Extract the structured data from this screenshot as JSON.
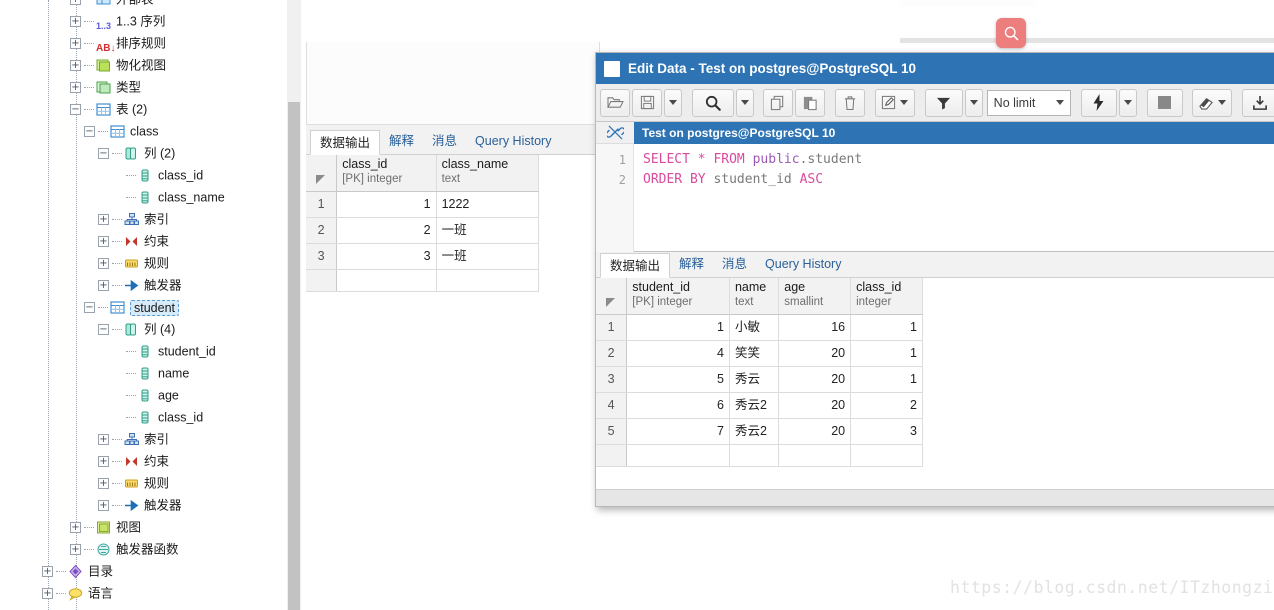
{
  "tree": {
    "items": [
      {
        "label": "外部表",
        "icon": "foreign-table-icon",
        "indent": 4,
        "twisty": "plus",
        "clipped": true,
        "selected": false
      },
      {
        "label": "1..3 序列",
        "icon": "sequence-icon",
        "indent": 4,
        "twisty": "plus",
        "selected": false
      },
      {
        "label": "排序规则",
        "icon": "collation-icon",
        "indent": 4,
        "twisty": "plus",
        "selected": false
      },
      {
        "label": "物化视图",
        "icon": "matview-icon",
        "indent": 4,
        "twisty": "plus",
        "selected": false
      },
      {
        "label": "类型",
        "icon": "type-icon",
        "indent": 4,
        "twisty": "plus",
        "selected": false
      },
      {
        "label": "表 (2)",
        "icon": "tables-icon",
        "indent": 4,
        "twisty": "minus",
        "selected": false
      },
      {
        "label": "class",
        "icon": "table-icon",
        "indent": 5,
        "twisty": "minus",
        "selected": false
      },
      {
        "label": "列 (2)",
        "icon": "columns-icon",
        "indent": 6,
        "twisty": "minus",
        "selected": false
      },
      {
        "label": "class_id",
        "icon": "column-icon",
        "indent": 7,
        "twisty": "none",
        "selected": false
      },
      {
        "label": "class_name",
        "icon": "column-icon",
        "indent": 7,
        "twisty": "none",
        "selected": false
      },
      {
        "label": "索引",
        "icon": "index-icon",
        "indent": 6,
        "twisty": "plus",
        "selected": false
      },
      {
        "label": "约束",
        "icon": "constraint-icon",
        "indent": 6,
        "twisty": "plus",
        "selected": false
      },
      {
        "label": "规则",
        "icon": "rule-icon",
        "indent": 6,
        "twisty": "plus",
        "selected": false
      },
      {
        "label": "触发器",
        "icon": "trigger-icon",
        "indent": 6,
        "twisty": "plus",
        "selected": false
      },
      {
        "label": "student",
        "icon": "table-icon",
        "indent": 5,
        "twisty": "minus",
        "selected": true
      },
      {
        "label": "列 (4)",
        "icon": "columns-icon",
        "indent": 6,
        "twisty": "minus",
        "selected": false
      },
      {
        "label": "student_id",
        "icon": "column-icon",
        "indent": 7,
        "twisty": "none",
        "selected": false
      },
      {
        "label": "name",
        "icon": "column-icon",
        "indent": 7,
        "twisty": "none",
        "selected": false
      },
      {
        "label": "age",
        "icon": "column-icon",
        "indent": 7,
        "twisty": "none",
        "selected": false
      },
      {
        "label": "class_id",
        "icon": "column-icon",
        "indent": 7,
        "twisty": "none",
        "selected": false
      },
      {
        "label": "索引",
        "icon": "index-icon",
        "indent": 6,
        "twisty": "plus",
        "selected": false
      },
      {
        "label": "约束",
        "icon": "constraint-icon",
        "indent": 6,
        "twisty": "plus",
        "selected": false
      },
      {
        "label": "规则",
        "icon": "rule-icon",
        "indent": 6,
        "twisty": "plus",
        "selected": false
      },
      {
        "label": "触发器",
        "icon": "trigger-icon",
        "indent": 6,
        "twisty": "plus",
        "selected": false
      },
      {
        "label": "视图",
        "icon": "view-icon",
        "indent": 4,
        "twisty": "plus",
        "selected": false
      },
      {
        "label": "触发器函数",
        "icon": "trigger-function-icon",
        "indent": 4,
        "twisty": "plus",
        "selected": false
      },
      {
        "label": "目录",
        "icon": "catalog-icon",
        "indent": 2,
        "twisty": "plus",
        "selected": false
      },
      {
        "label": "语言",
        "icon": "language-icon",
        "indent": 2,
        "twisty": "plus",
        "selected": false
      }
    ]
  },
  "background_result": {
    "tabs": [
      {
        "label": "数据输出",
        "active": true
      },
      {
        "label": "解释",
        "active": false
      },
      {
        "label": "消息",
        "active": false
      },
      {
        "label": "Query History",
        "active": false
      }
    ],
    "columns": [
      {
        "name": "class_id",
        "type": "[PK] integer",
        "align": "right"
      },
      {
        "name": "class_name",
        "type": "text",
        "align": "left"
      }
    ],
    "rows": [
      {
        "n": "1",
        "cells": [
          "1",
          "1222"
        ]
      },
      {
        "n": "2",
        "cells": [
          "2",
          "一班"
        ]
      },
      {
        "n": "3",
        "cells": [
          "3",
          "一班"
        ]
      }
    ]
  },
  "search_badge": {
    "icon": "search-icon",
    "color": "#ec7e7e"
  },
  "dialog": {
    "title": "Edit Data - Test on postgres@PostgreSQL 10",
    "titlebar_color": "#2e74b5",
    "toolbar": [
      {
        "name": "open-file-button",
        "icon": "folder-open-icon",
        "type": "button"
      },
      {
        "name": "save-file-button",
        "icon": "save-disk-icon",
        "type": "button"
      },
      {
        "name": "save-dropdown-button",
        "icon": "chevron-down-icon",
        "type": "dropdown"
      },
      {
        "name": "find-button",
        "icon": "search-icon",
        "type": "button"
      },
      {
        "name": "find-dropdown-button",
        "icon": "chevron-down-icon",
        "type": "dropdown"
      },
      {
        "name": "copy-button",
        "icon": "copy-icon",
        "type": "button"
      },
      {
        "name": "paste-button",
        "icon": "paste-icon",
        "type": "button"
      },
      {
        "name": "delete-button",
        "icon": "trash-icon",
        "type": "button"
      },
      {
        "name": "edit-button",
        "icon": "pencil-square-icon",
        "type": "dropdown-button"
      },
      {
        "name": "filter-button",
        "icon": "funnel-icon",
        "type": "button"
      },
      {
        "name": "filter-dropdown-button",
        "icon": "chevron-down-icon",
        "type": "dropdown"
      },
      {
        "name": "row-limit-select",
        "icon": "chevron-down-icon",
        "type": "select",
        "value": "No limit"
      },
      {
        "name": "execute-button",
        "icon": "lightning-bolt-icon",
        "type": "button"
      },
      {
        "name": "execute-dropdown-button",
        "icon": "chevron-down-icon",
        "type": "dropdown"
      },
      {
        "name": "stop-button",
        "icon": "stop-square-icon",
        "type": "button"
      },
      {
        "name": "clear-button",
        "icon": "eraser-icon",
        "type": "dropdown-button"
      },
      {
        "name": "download-button",
        "icon": "download-icon",
        "type": "button"
      }
    ],
    "limit": {
      "value": "No limit"
    },
    "editor": {
      "connection_icon": "broken-link-icon",
      "connection_label": "Test on postgres@PostgreSQL 10",
      "lines": [
        {
          "num": "1",
          "tokens": [
            {
              "t": "SELECT",
              "c": "kw"
            },
            {
              "t": " ",
              "c": "plain"
            },
            {
              "t": "*",
              "c": "op"
            },
            {
              "t": " ",
              "c": "plain"
            },
            {
              "t": "FROM",
              "c": "kw"
            },
            {
              "t": " ",
              "c": "plain"
            },
            {
              "t": "public",
              "c": "schema"
            },
            {
              "t": ".",
              "c": "ident"
            },
            {
              "t": "student",
              "c": "ident"
            }
          ]
        },
        {
          "num": "2",
          "tokens": [
            {
              "t": "ORDER",
              "c": "kw"
            },
            {
              "t": " ",
              "c": "plain"
            },
            {
              "t": "BY",
              "c": "kw"
            },
            {
              "t": " ",
              "c": "plain"
            },
            {
              "t": "student_id",
              "c": "ident"
            },
            {
              "t": " ",
              "c": "plain"
            },
            {
              "t": "ASC",
              "c": "kw"
            }
          ]
        }
      ]
    },
    "result": {
      "tabs": [
        {
          "label": "数据输出",
          "active": true
        },
        {
          "label": "解释",
          "active": false
        },
        {
          "label": "消息",
          "active": false
        },
        {
          "label": "Query History",
          "active": false
        }
      ],
      "columns": [
        {
          "name": "student_id",
          "type": "[PK] integer",
          "align": "right"
        },
        {
          "name": "name",
          "type": "text",
          "align": "left"
        },
        {
          "name": "age",
          "type": "smallint",
          "align": "right"
        },
        {
          "name": "class_id",
          "type": "integer",
          "align": "right"
        }
      ],
      "rows": [
        {
          "n": "1",
          "cells": [
            "1",
            "小敏",
            "16",
            "1"
          ]
        },
        {
          "n": "2",
          "cells": [
            "4",
            "笑笑",
            "20",
            "1"
          ]
        },
        {
          "n": "3",
          "cells": [
            "5",
            "秀云",
            "20",
            "1"
          ]
        },
        {
          "n": "4",
          "cells": [
            "6",
            "秀云2",
            "20",
            "2"
          ]
        },
        {
          "n": "5",
          "cells": [
            "7",
            "秀云2",
            "20",
            "3"
          ]
        }
      ]
    }
  },
  "watermark": {
    "text": "https://blog.csdn.net/ITzhongzi"
  }
}
